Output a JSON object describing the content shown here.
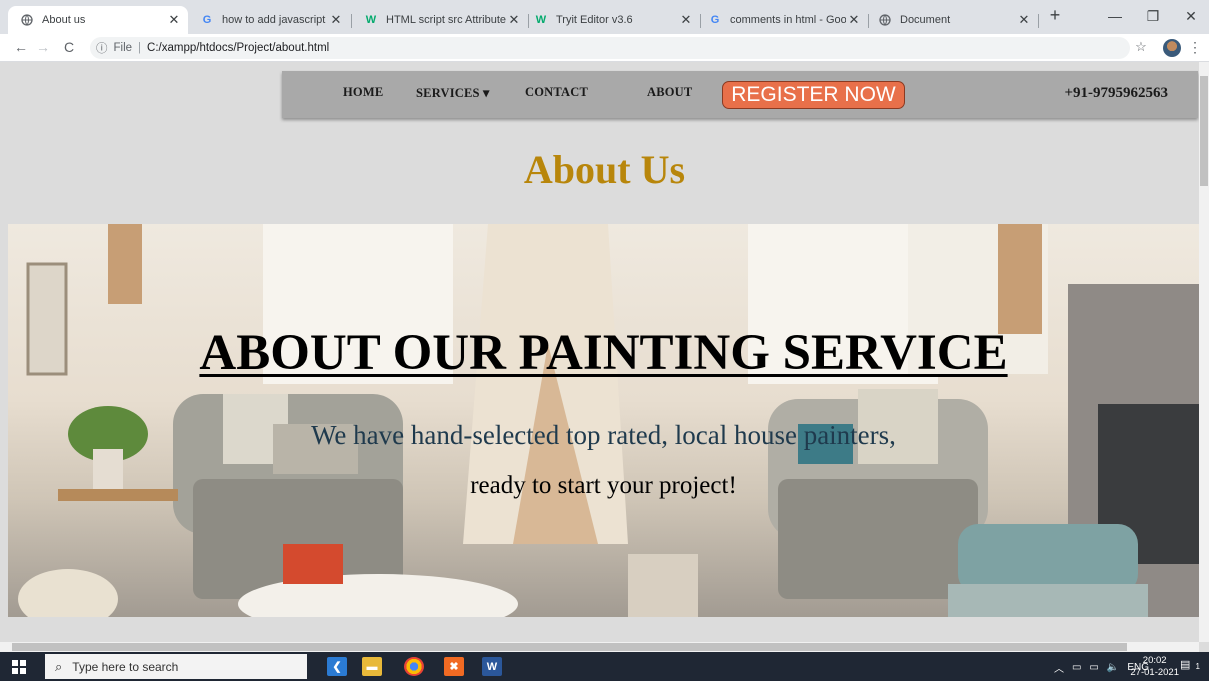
{
  "browser": {
    "tabs": [
      {
        "title": "About us",
        "favicon": "globe-icon",
        "active": true
      },
      {
        "title": "how to add javascript in html",
        "favicon": "google-g-icon"
      },
      {
        "title": "HTML script src Attribute",
        "favicon": "w3schools-icon"
      },
      {
        "title": "Tryit Editor v3.6",
        "favicon": "w3schools-icon"
      },
      {
        "title": "comments in html - Google",
        "favicon": "google-g-icon"
      },
      {
        "title": "Document",
        "favicon": "globe-icon"
      }
    ],
    "new_tab": "+",
    "address": {
      "scheme": "File",
      "path": "C:/xampp/htdocs/Project/about.html"
    }
  },
  "nav": {
    "home": "HOME",
    "services": "SERVICES",
    "services_caret": "▾",
    "contact": "CONTACT",
    "about": "ABOUT",
    "register": "REGISTER NOW",
    "phone": "+91-9795962563"
  },
  "page": {
    "title": "About Us",
    "hero_title": "ABOUT OUR PAINTING SERVICE",
    "hero_sub1": "We have hand-selected top rated, local house painters,",
    "hero_sub2": "ready to start your project!"
  },
  "taskbar": {
    "search_placeholder": "Type here to search",
    "lang": "ENG",
    "time": "20:02",
    "date": "27-01-2021",
    "notification_count": "1"
  },
  "colors": {
    "page_bg": "#dcdcdc",
    "navbar_bg": "#a9a9a9",
    "register_bg": "#e8704a",
    "title_color": "#b8860b"
  }
}
